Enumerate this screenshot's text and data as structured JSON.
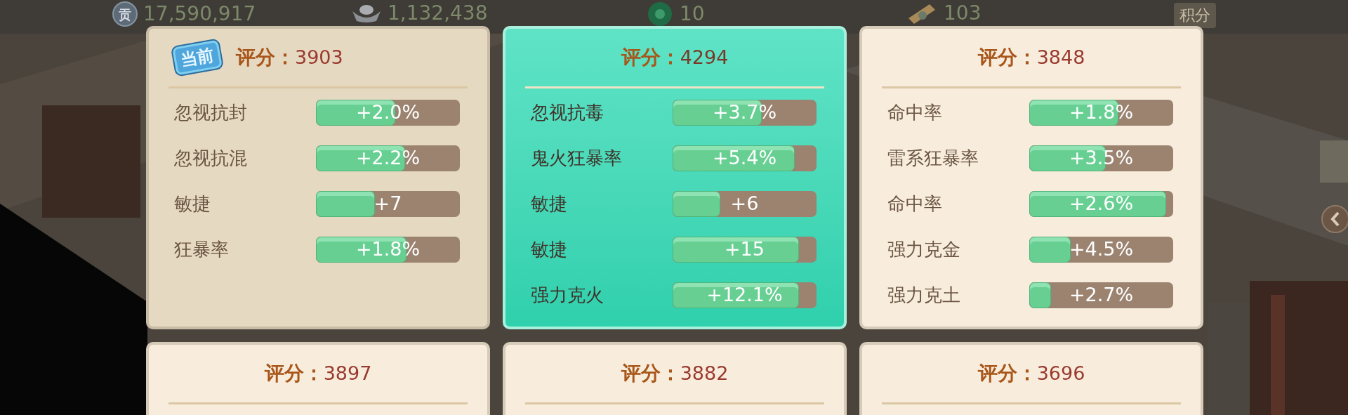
{
  "top_bar": {
    "items": [
      {
        "kind": "coin",
        "icon_text": "贡",
        "value": "17,590,917"
      },
      {
        "kind": "ingot",
        "value": "1,132,438"
      },
      {
        "kind": "jade",
        "value": "10"
      },
      {
        "kind": "scroll",
        "value": "103"
      }
    ],
    "button": "积分"
  },
  "cards": [
    {
      "selected": false,
      "badge": "当前",
      "score_label": "评分：",
      "score": "3903",
      "stats": [
        {
          "name": "忽视抗封",
          "value": "+2.0%",
          "level": 0.55
        },
        {
          "name": "忽视抗混",
          "value": "+2.2%",
          "level": 0.62
        },
        {
          "name": "敏捷",
          "value": "+7",
          "level": 0.41
        },
        {
          "name": "狂暴率",
          "value": "+1.8%",
          "level": 0.63
        }
      ]
    },
    {
      "selected": true,
      "score_label": "评分：",
      "score": "4294",
      "stats": [
        {
          "name": "忽视抗毒",
          "value": "+3.7%",
          "level": 0.62
        },
        {
          "name": "鬼火狂暴率",
          "value": "+5.4%",
          "level": 0.85
        },
        {
          "name": "敏捷",
          "value": "+6",
          "level": 0.33
        },
        {
          "name": "敏捷",
          "value": "+15",
          "level": 0.88
        },
        {
          "name": "强力克火",
          "value": "+12.1%",
          "level": 0.88
        }
      ]
    },
    {
      "selected": false,
      "score_label": "评分：",
      "score": "3848",
      "stats": [
        {
          "name": "命中率",
          "value": "+1.8%",
          "level": 0.62
        },
        {
          "name": "雷系狂暴率",
          "value": "+3.5%",
          "level": 0.53
        },
        {
          "name": "命中率",
          "value": "+2.6%",
          "level": 0.95
        },
        {
          "name": "强力克金",
          "value": "+4.5%",
          "level": 0.29
        },
        {
          "name": "强力克土",
          "value": "+2.7%",
          "level": 0.15
        }
      ]
    },
    {
      "selected": false,
      "score_label": "评分：",
      "score": "3897"
    },
    {
      "selected": false,
      "score_label": "评分：",
      "score": "3882"
    },
    {
      "selected": false,
      "score_label": "评分：",
      "score": "3696"
    }
  ]
}
